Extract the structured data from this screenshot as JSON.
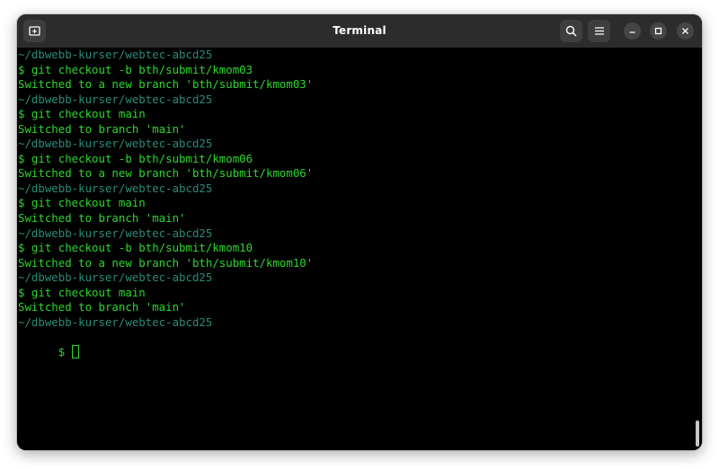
{
  "window": {
    "title": "Terminal"
  },
  "titlebar": {
    "new_tab_icon": "new-tab-icon",
    "search_icon": "search-icon",
    "menu_icon": "hamburger-menu-icon",
    "minimize_icon": "minimize-icon",
    "maximize_icon": "maximize-icon",
    "close_icon": "close-icon"
  },
  "colors": {
    "path": "#2a8a78",
    "command": "#2bd82b",
    "output": "#2bd82b",
    "background": "#000000",
    "titlebar": "#2c2c2c"
  },
  "terminal": {
    "lines": [
      {
        "type": "path",
        "text": "~/dbwebb-kurser/webtec-abcd25"
      },
      {
        "type": "cmd",
        "text": "$ git checkout -b bth/submit/kmom03"
      },
      {
        "type": "out",
        "text": "Switched to a new branch 'bth/submit/kmom03'"
      },
      {
        "type": "path",
        "text": "~/dbwebb-kurser/webtec-abcd25"
      },
      {
        "type": "cmd",
        "text": "$ git checkout main"
      },
      {
        "type": "out",
        "text": "Switched to branch 'main'"
      },
      {
        "type": "path",
        "text": "~/dbwebb-kurser/webtec-abcd25"
      },
      {
        "type": "cmd",
        "text": "$ git checkout -b bth/submit/kmom06"
      },
      {
        "type": "out",
        "text": "Switched to a new branch 'bth/submit/kmom06'"
      },
      {
        "type": "path",
        "text": "~/dbwebb-kurser/webtec-abcd25"
      },
      {
        "type": "cmd",
        "text": "$ git checkout main"
      },
      {
        "type": "out",
        "text": "Switched to branch 'main'"
      },
      {
        "type": "path",
        "text": "~/dbwebb-kurser/webtec-abcd25"
      },
      {
        "type": "cmd",
        "text": "$ git checkout -b bth/submit/kmom10"
      },
      {
        "type": "out",
        "text": "Switched to a new branch 'bth/submit/kmom10'"
      },
      {
        "type": "path",
        "text": "~/dbwebb-kurser/webtec-abcd25"
      },
      {
        "type": "cmd",
        "text": "$ git checkout main"
      },
      {
        "type": "out",
        "text": "Switched to branch 'main'"
      },
      {
        "type": "path",
        "text": "~/dbwebb-kurser/webtec-abcd25"
      }
    ],
    "prompt": "$ "
  }
}
